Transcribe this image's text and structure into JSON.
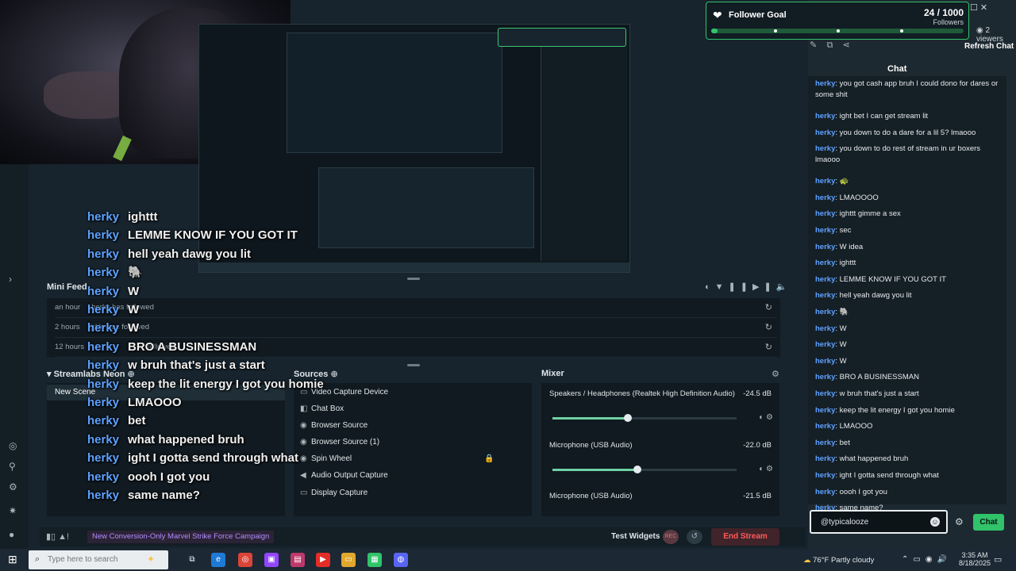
{
  "goal": {
    "title": "Follower Goal",
    "count": "24 / 1000",
    "unit": "Followers",
    "progress": 0.024,
    "viewers": "2 viewers",
    "heart_icon": "heart-icon"
  },
  "chat_panel": {
    "refresh_label": "Refresh Chat",
    "header": "Chat",
    "messages": [
      {
        "user": "herky",
        "text": "you got cash app bruh I could dono for dares or some shit"
      },
      {
        "user": "herky",
        "text": "ight bet I can get stream lit"
      },
      {
        "user": "herky",
        "text": "you down to do a dare for a lil 5? lmaooo"
      },
      {
        "user": "herky",
        "text": "you down to do rest of stream in ur boxers lmaooo"
      },
      {
        "user": "herky",
        "text": "🐢"
      },
      {
        "user": "herky",
        "text": "LMAOOOO"
      },
      {
        "user": "herky",
        "text": "ighttt gimme a sex"
      },
      {
        "user": "herky",
        "text": "sec"
      },
      {
        "user": "herky",
        "text": "W idea"
      },
      {
        "user": "herky",
        "text": "ighttt"
      },
      {
        "user": "herky",
        "text": "LEMME KNOW IF YOU GOT IT"
      },
      {
        "user": "herky",
        "text": "hell yeah dawg you lit"
      },
      {
        "user": "herky",
        "text": "🐘"
      },
      {
        "user": "herky",
        "text": "W"
      },
      {
        "user": "herky",
        "text": "W"
      },
      {
        "user": "herky",
        "text": "W"
      },
      {
        "user": "herky",
        "text": "BRO A BUSINESSMAN"
      },
      {
        "user": "herky",
        "text": "w bruh that's just a start"
      },
      {
        "user": "herky",
        "text": "keep the lit energy I got you homie"
      },
      {
        "user": "herky",
        "text": "LMAOOO"
      },
      {
        "user": "herky",
        "text": "bet"
      },
      {
        "user": "herky",
        "text": "what happened bruh"
      },
      {
        "user": "herky",
        "text": "ight I gotta send through what"
      },
      {
        "user": "herky",
        "text": "oooh I got you"
      },
      {
        "user": "herky",
        "text": "same name?"
      }
    ],
    "input_value": "@typicalooze",
    "send_label": "Chat"
  },
  "overlay_chat": [
    {
      "user": "herky",
      "text": "ighttt"
    },
    {
      "user": "herky",
      "text": "LEMME KNOW IF YOU GOT IT"
    },
    {
      "user": "herky",
      "text": "hell yeah dawg you lit"
    },
    {
      "user": "herky",
      "text": "🐘"
    },
    {
      "user": "herky",
      "text": "W"
    },
    {
      "user": "herky",
      "text": "W"
    },
    {
      "user": "herky",
      "text": "W"
    },
    {
      "user": "herky",
      "text": "BRO A BUSINESSMAN"
    },
    {
      "user": "herky",
      "text": "w bruh that's just a start"
    },
    {
      "user": "herky",
      "text": "keep the lit energy I got you homie"
    },
    {
      "user": "herky",
      "text": "LMAOOO"
    },
    {
      "user": "herky",
      "text": "bet"
    },
    {
      "user": "herky",
      "text": "what happened bruh"
    },
    {
      "user": "herky",
      "text": "ight I gotta send through what"
    },
    {
      "user": "herky",
      "text": "oooh I got you"
    },
    {
      "user": "herky",
      "text": "same name?"
    }
  ],
  "mini_feed": {
    "title": "Mini Feed",
    "rows": [
      {
        "time": "an hour",
        "text": "herky has followed"
      },
      {
        "time": "2 hours",
        "text": "jrkkr has followed"
      },
      {
        "time": "12 hours",
        "text": "followed"
      }
    ]
  },
  "scenes": {
    "title": "Streamlabs Neon",
    "items": [
      "New Scene"
    ]
  },
  "sources": {
    "title": "Sources",
    "items": [
      {
        "label": "Video Capture Device",
        "icon": "camera-icon"
      },
      {
        "label": "Chat Box",
        "icon": "chat-icon"
      },
      {
        "label": "Browser Source",
        "icon": "globe-icon"
      },
      {
        "label": "Browser Source (1)",
        "icon": "globe-icon"
      },
      {
        "label": "Spin Wheel",
        "icon": "globe-icon"
      },
      {
        "label": "Audio Output Capture",
        "icon": "speaker-icon"
      },
      {
        "label": "Display Capture",
        "icon": "monitor-icon"
      }
    ]
  },
  "mixer": {
    "title": "Mixer",
    "channels": [
      {
        "name": "Speakers / Headphones (Realtek High Definition Audio)",
        "db": "-24.5 dB",
        "level": 0.41
      },
      {
        "name": "Microphone (USB Audio)",
        "db": "-22.0 dB",
        "level": 0.46
      },
      {
        "name": "Microphone (USB Audio)",
        "db": "-21.5 dB",
        "level": 0.0
      }
    ]
  },
  "footer": {
    "campaign": "New Conversion-Only Marvel Strike Force Campaign",
    "test_widgets": "Test Widgets",
    "rec_label": "REC",
    "end_stream": "End Stream"
  },
  "taskbar": {
    "search_placeholder": "Type here to search",
    "weather": "76°F  Partly cloudy",
    "time": "3:35 AM",
    "date": "8/18/2025"
  },
  "colors": {
    "accent_green": "#31c36a",
    "username_blue": "#5ea2ff",
    "end_stream_red": "#ff5a5a"
  }
}
